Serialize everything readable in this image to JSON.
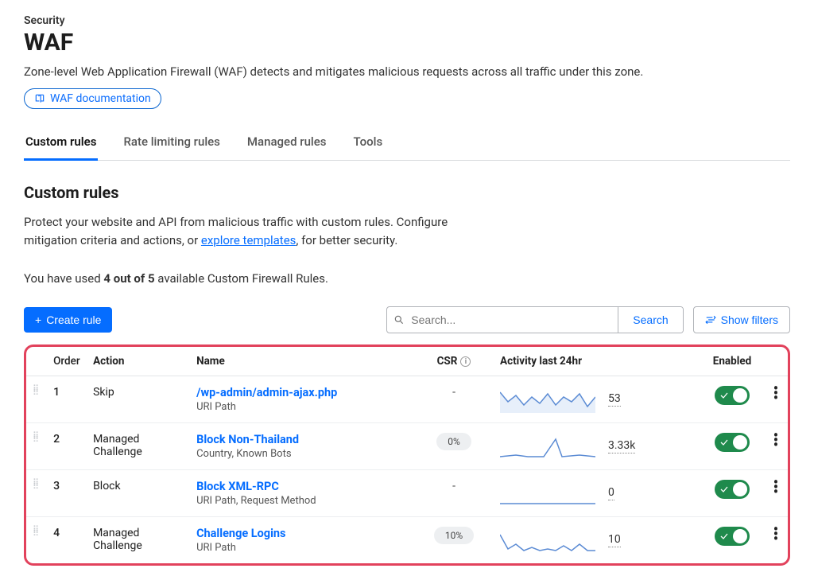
{
  "header": {
    "breadcrumb": "Security",
    "title": "WAF",
    "description": "Zone-level Web Application Firewall (WAF) detects and mitigates malicious requests across all traffic under this zone.",
    "doc_link_label": "WAF documentation"
  },
  "tabs": [
    {
      "label": "Custom rules",
      "active": true
    },
    {
      "label": "Rate limiting rules",
      "active": false
    },
    {
      "label": "Managed rules",
      "active": false
    },
    {
      "label": "Tools",
      "active": false
    }
  ],
  "section": {
    "title": "Custom rules",
    "desc_before": "Protect your website and API from malicious traffic with custom rules. Configure mitigation criteria and actions, or ",
    "desc_link": "explore templates",
    "desc_after": ", for better security.",
    "usage_before": "You have used ",
    "usage_bold": "4 out of 5",
    "usage_after": " available Custom Firewall Rules."
  },
  "toolbar": {
    "create_label": "Create rule",
    "search_placeholder": "Search...",
    "search_button": "Search",
    "filters_button": "Show filters"
  },
  "table": {
    "columns": {
      "order": "Order",
      "action": "Action",
      "name": "Name",
      "csr": "CSR",
      "activity": "Activity last 24hr",
      "enabled": "Enabled"
    },
    "rows": [
      {
        "order": "1",
        "action": "Skip",
        "name": "/wp-admin/admin-ajax.php",
        "subtitle": "URI Path",
        "csr": "-",
        "csr_pill": false,
        "activity_count": "53",
        "spark": "fill",
        "enabled": true
      },
      {
        "order": "2",
        "action": "Managed Challenge",
        "name": "Block Non-Thailand",
        "subtitle": "Country, Known Bots",
        "csr": "0%",
        "csr_pill": true,
        "activity_count": "3.33k",
        "spark": "spike",
        "enabled": true
      },
      {
        "order": "3",
        "action": "Block",
        "name": "Block XML-RPC",
        "subtitle": "URI Path, Request Method",
        "csr": "-",
        "csr_pill": false,
        "activity_count": "0",
        "spark": "flat",
        "enabled": true
      },
      {
        "order": "4",
        "action": "Managed Challenge",
        "name": "Challenge Logins",
        "subtitle": "URI Path",
        "csr": "10%",
        "csr_pill": true,
        "activity_count": "10",
        "spark": "jagged",
        "enabled": true
      }
    ]
  }
}
